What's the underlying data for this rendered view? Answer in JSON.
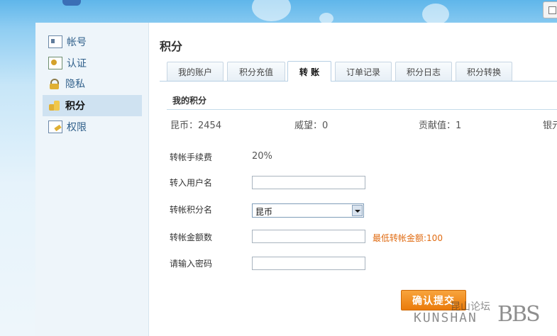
{
  "sidebar": {
    "items": [
      {
        "label": "帐号",
        "icon": "account-card-icon"
      },
      {
        "label": "认证",
        "icon": "verify-icon"
      },
      {
        "label": "隐私",
        "icon": "lock-icon"
      },
      {
        "label": "积分",
        "icon": "coins-icon",
        "active": true
      },
      {
        "label": "权限",
        "icon": "permission-icon"
      }
    ]
  },
  "main": {
    "title": "积分",
    "tabs": [
      {
        "label": "我的账户"
      },
      {
        "label": "积分充值"
      },
      {
        "label": "转 账",
        "active": true
      },
      {
        "label": "订单记录"
      },
      {
        "label": "积分日志"
      },
      {
        "label": "积分转换"
      }
    ],
    "section_title": "我的积分",
    "stats": [
      {
        "text": "昆币：2454"
      },
      {
        "text": "威望：0"
      },
      {
        "text": "贡献值：1"
      },
      {
        "text": "银元"
      }
    ]
  },
  "form": {
    "fee_label": "转帐手续费",
    "fee_value": "20%",
    "recipient_label": "转入用户名",
    "recipient_value": "",
    "points_label": "转帐积分名",
    "points_selected": "昆币",
    "amount_label": "转帐金额数",
    "amount_value": "",
    "min_note": "最低转帐金额:100",
    "password_label": "请输入密码",
    "password_value": "",
    "submit_label": "确认提交"
  },
  "watermark": {
    "cn": "昆山论坛",
    "en": "KUNSHAN",
    "bbs": "BBS"
  },
  "colors": {
    "accent_orange": "#ea7b0b",
    "note_orange": "#e06b12",
    "sidebar_bg": "#eef5fa",
    "active_nav_bg": "#cfe2f1"
  }
}
